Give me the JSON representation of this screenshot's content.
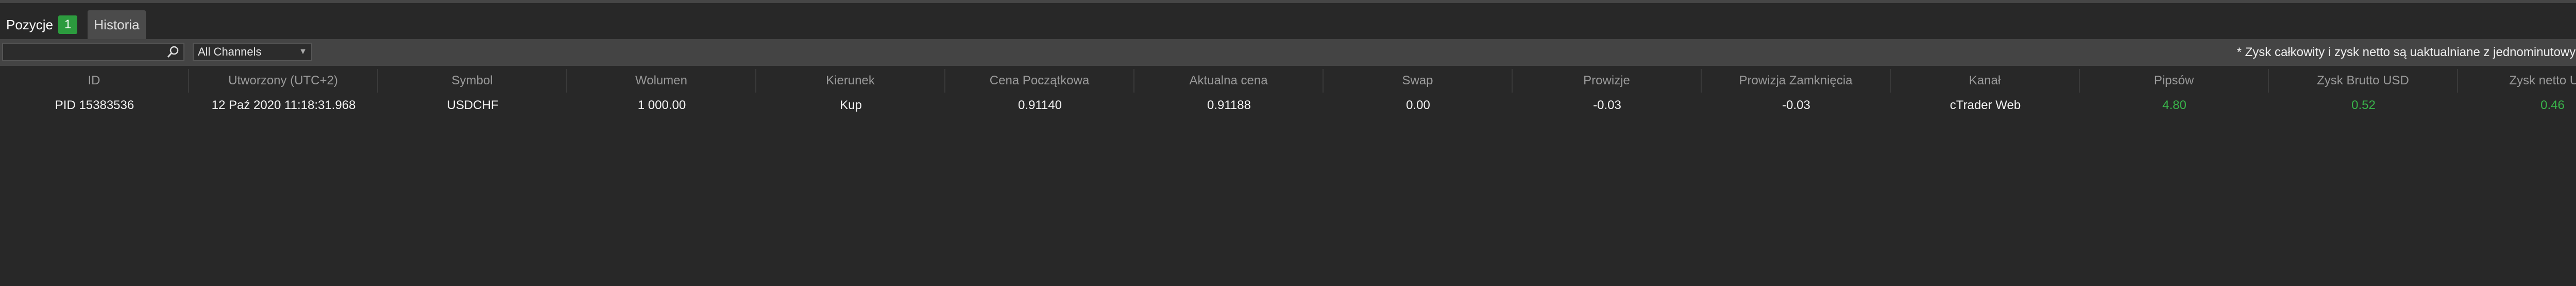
{
  "tabs": [
    {
      "label": "Pozycje",
      "count": "1"
    },
    {
      "label": "Historia"
    }
  ],
  "toolbar": {
    "search_placeholder": "",
    "channel_selected": "All Channels",
    "note": "* Zysk całkowity i zysk netto są uaktualniane z jednominutowym opóźnieniem"
  },
  "table": {
    "columns": [
      "ID",
      "Utworzony (UTC+2)",
      "Symbol",
      "Wolumen",
      "Kierunek",
      "Cena Początkowa",
      "Aktualna cena",
      "Swap",
      "Prowizje",
      "Prowizja Zamknięcia",
      "Kanał",
      "Pipsów",
      "Zysk Brutto USD",
      "Zysk netto USD"
    ],
    "rows": [
      [
        "PID 15383536",
        "12 Paź 2020 11:18:31.968",
        "USDCHF",
        "1 000.00",
        "Kup",
        "0.91140",
        "0.91188",
        "0.00",
        "-0.03",
        "-0.03",
        "cTrader Web",
        "4.80",
        "0.52",
        "0.46"
      ]
    ]
  },
  "colors": {
    "profit_green": "#39b54a",
    "badge_green": "#2c9b3e"
  }
}
